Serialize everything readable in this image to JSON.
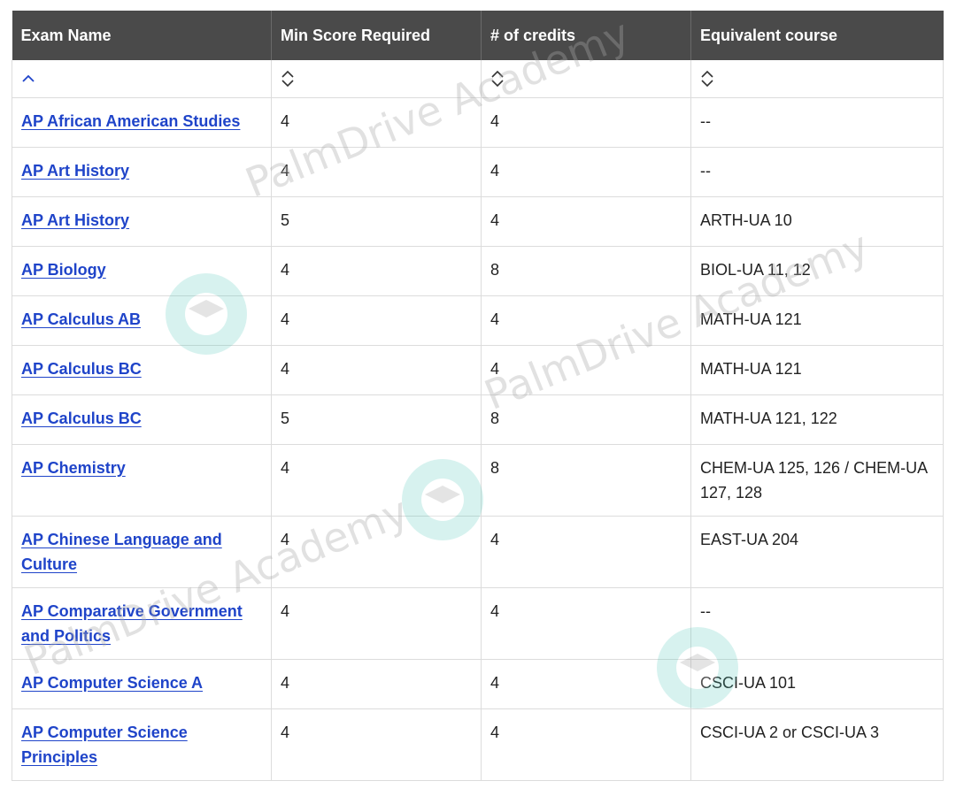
{
  "table": {
    "headers": {
      "exam_name": "Exam Name",
      "min_score": "Min Score Required",
      "credits": "# of credits",
      "equivalent": "Equivalent course"
    },
    "sort_icons": {
      "exam_name": "sort-ascending-icon",
      "other": "sort-both-icon"
    },
    "rows": [
      {
        "exam": "AP African American Studies",
        "score": "4",
        "credits": "4",
        "equiv": "--"
      },
      {
        "exam": "AP Art History",
        "score": "4",
        "credits": "4",
        "equiv": "--"
      },
      {
        "exam": "AP Art History",
        "score": "5",
        "credits": "4",
        "equiv": "ARTH-UA 10"
      },
      {
        "exam": "AP Biology",
        "score": "4",
        "credits": "8",
        "equiv": "BIOL-UA 11, 12"
      },
      {
        "exam": "AP Calculus AB",
        "score": "4",
        "credits": "4",
        "equiv": "MATH-UA 121"
      },
      {
        "exam": "AP Calculus BC",
        "score": "4",
        "credits": "4",
        "equiv": "MATH-UA 121"
      },
      {
        "exam": "AP Calculus BC",
        "score": "5",
        "credits": "8",
        "equiv": "MATH-UA 121, 122"
      },
      {
        "exam": "AP Chemistry",
        "score": "4",
        "credits": "8",
        "equiv": "CHEM-UA 125, 126 / CHEM-UA 127, 128"
      },
      {
        "exam": "AP Chinese Language and Culture",
        "score": "4",
        "credits": "4",
        "equiv": "EAST-UA 204"
      },
      {
        "exam": "AP Comparative Government and Politics",
        "score": "4",
        "credits": "4",
        "equiv": "--"
      },
      {
        "exam": "AP Computer Science A",
        "score": "4",
        "credits": "4",
        "equiv": "CSCI-UA 101"
      },
      {
        "exam": "AP Computer Science Principles",
        "score": "4",
        "credits": "4",
        "equiv": "CSCI-UA 2 or CSCI-UA 3"
      }
    ]
  },
  "watermark": {
    "text": "PalmDrive Academy",
    "color": "#aaaaaa",
    "logo_color": "#4fc9b8"
  },
  "colors": {
    "header_bg": "#4a4a4a",
    "header_text": "#ffffff",
    "link": "#1f44c9",
    "border": "#dcdcdc"
  }
}
